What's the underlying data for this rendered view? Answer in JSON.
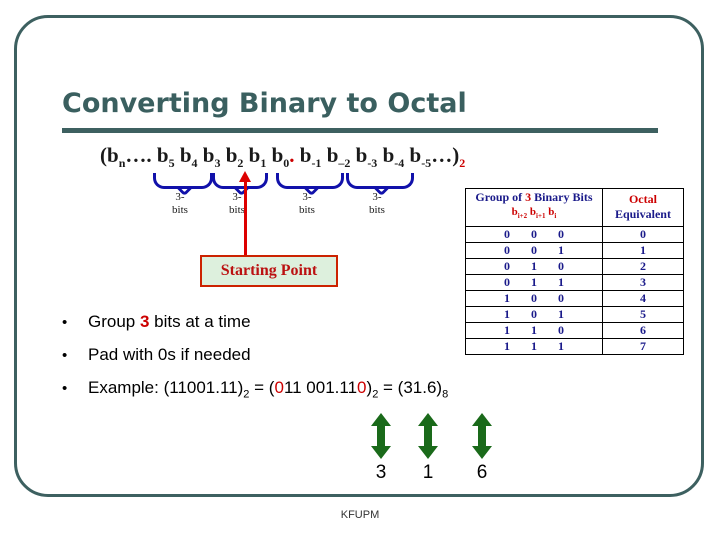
{
  "slide": {
    "title": "Converting Binary to Octal",
    "footer": "KFUPM",
    "accent_color": "#3d6060",
    "highlight_color": "#cc0000",
    "table_text_color": "#1a1a8a",
    "arrow_color": "#1a6a1a"
  },
  "diagram": {
    "formula_prefix": "(b",
    "formula_full": "(bn…. b5 b4 b3 b2 b1 b0 . b-1 b-2 b-3 b-4 b-5…)2",
    "formula_tokens": [
      {
        "base": "(b",
        "sub": "n"
      },
      {
        "base": "…. b",
        "sub": "5"
      },
      {
        "base": " b",
        "sub": "4"
      },
      {
        "base": " b",
        "sub": "3"
      },
      {
        "base": " b",
        "sub": "2"
      },
      {
        "base": " b",
        "sub": "1"
      },
      {
        "base": " b",
        "sub": "0"
      }
    ],
    "radix_point": ".",
    "formula_tokens_frac": [
      {
        "base": " b",
        "sub": "-1"
      },
      {
        "base": " b",
        "sub": "-2"
      },
      {
        "base": " b",
        "sub": "-3"
      },
      {
        "base": " b",
        "sub": "-4"
      },
      {
        "base": " b",
        "sub": "-5"
      }
    ],
    "formula_tail": "…)",
    "formula_base": "2",
    "group_labels": [
      "3-bits",
      "3-bits",
      "3-bits",
      "3-bits"
    ],
    "group_label_line1": "3-",
    "group_label_line2": "bits",
    "starting_point_label": "Starting Point",
    "starting_point_bg": "#ddf0dd",
    "starting_point_border": "#cc2200",
    "brace_color": "#1111aa",
    "pointer_color": "#dd0000"
  },
  "octal_table": {
    "header_group": "Group of 3 Binary Bits",
    "header_group_highlight": "3",
    "header_group_sub_parts": [
      {
        "base": "b",
        "sub": "i+2"
      },
      {
        "base": " b",
        "sub": "i+1"
      },
      {
        "base": " b",
        "sub": "i"
      }
    ],
    "header_octal_line1": "Octal",
    "header_octal_line2": "Equivalent",
    "rows": [
      {
        "bits": "0 0 0",
        "octal": "0"
      },
      {
        "bits": "0 0 1",
        "octal": "1"
      },
      {
        "bits": "0 1 0",
        "octal": "2"
      },
      {
        "bits": "0 1 1",
        "octal": "3"
      },
      {
        "bits": "1 0 0",
        "octal": "4"
      },
      {
        "bits": "1 0 1",
        "octal": "5"
      },
      {
        "bits": "1 1 0",
        "octal": "6"
      },
      {
        "bits": "1 1 1",
        "octal": "7"
      }
    ]
  },
  "bullets": {
    "b1_pre": "Group ",
    "b1_highlight": "3",
    "b1_post": " bits at a time",
    "b2": "Pad with 0s if needed",
    "b3_label": "Example: (11001.11)",
    "b3_sub1": "2",
    "b3_eq1": " = (",
    "b3_pad_left": "0",
    "b3_mid": "11 001.11",
    "b3_pad_right": "0",
    "b3_close": ")",
    "b3_sub2": "2",
    "b3_eq2": " = (31.6)",
    "b3_sub3": "8"
  },
  "result_digits": {
    "digits": [
      "3",
      "1",
      "6"
    ],
    "arrow_count": 3
  }
}
